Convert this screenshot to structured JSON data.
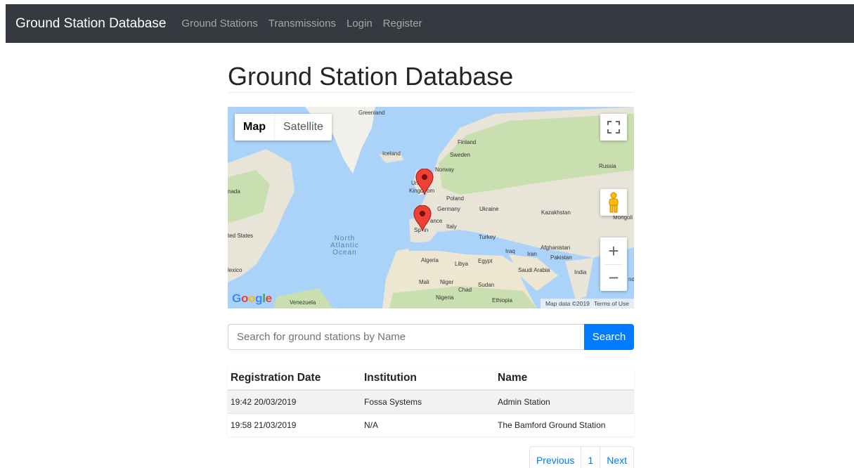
{
  "navbar": {
    "brand": "Ground Station Database",
    "links": [
      "Ground Stations",
      "Transmissions",
      "Login",
      "Register"
    ]
  },
  "page": {
    "title": "Ground Station Database"
  },
  "map": {
    "type_buttons": [
      "Map",
      "Satellite"
    ],
    "fullscreen_icon": "fullscreen-icon",
    "pegman_icon": "pegman-icon",
    "zoom_in": "+",
    "zoom_out": "−",
    "logo": "Google",
    "attribution": "Map data ©2019",
    "terms": "Terms of Use",
    "labels": {
      "greenland": "Greenland",
      "iceland": "Iceland",
      "finland": "Finland",
      "sweden": "Sweden",
      "norway": "Norway",
      "russia": "Russia",
      "uk_1": "Un",
      "uk_2": "Kingd",
      "uk_3": "om",
      "poland": "Poland",
      "germany": "Germany",
      "ukraine": "Ukraine",
      "kazakhstan": "Kazakhstan",
      "mongolia": "Mongoli",
      "france": "ance",
      "italy": "Italy",
      "spain_1": "Sp",
      "spain_2": "in",
      "turkey": "Turkey",
      "canada": "nada",
      "us": "ted States",
      "ocean": "North\nAtlantic\nOcean",
      "iraq": "Iraq",
      "iran": "Iran",
      "afghanistan": "Afghanistan",
      "pakistan": "Pakistan",
      "algeria": "Algeria",
      "libya": "Libya",
      "egypt": "Egypt",
      "saudi": "Saudi Arabia",
      "india": "India",
      "mexico": "lexico",
      "mali": "Mali",
      "niger": "Niger",
      "chad": "Chad",
      "sudan": "Sudan",
      "nigeria": "Nigeria",
      "ethiopia": "Ethiopia",
      "venezuela": "Venezuela",
      "na": "na",
      "nd": "nd"
    },
    "pins": [
      "map-pin-uk",
      "map-pin-spain"
    ],
    "colors": {
      "water": "#abd3f9",
      "land": "#e8e4d8",
      "green": "#c9dfb0",
      "pin": "#ea4335"
    }
  },
  "search": {
    "placeholder": "Search for ground stations by Name",
    "button": "Search"
  },
  "table": {
    "headers": [
      "Registration Date",
      "Institution",
      "Name"
    ],
    "rows": [
      [
        "19:42 20/03/2019",
        "Fossa Systems",
        "Admin Station"
      ],
      [
        "19:58 21/03/2019",
        "N/A",
        "The Bamford Ground Station"
      ]
    ]
  },
  "pagination": {
    "previous": "Previous",
    "page": "1",
    "next": "Next"
  },
  "colors": {
    "navbar": "#343a40",
    "primary": "#007bff"
  }
}
